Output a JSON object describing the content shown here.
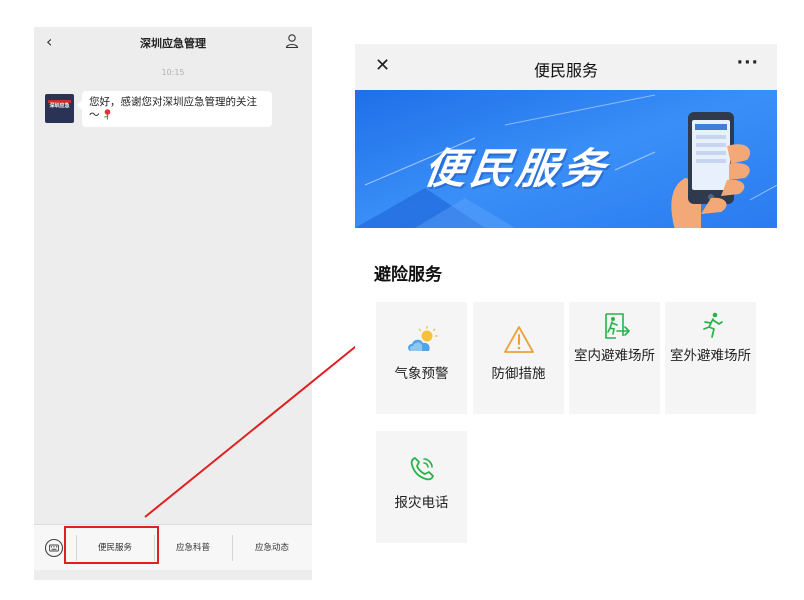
{
  "chat": {
    "back_icon": "chevron-left-icon",
    "title": "深圳应急管理",
    "user_icon": "person-icon",
    "time": "10:15",
    "message": "您好，感谢您对深圳应急管理的关注～",
    "avatar_text": "深圳应急",
    "menu": {
      "keyboard_icon": "keyboard-icon",
      "items": [
        {
          "label": "便民服务",
          "highlighted": true
        },
        {
          "label": "应急科普",
          "highlighted": false
        },
        {
          "label": "应急动态",
          "highlighted": false
        }
      ]
    }
  },
  "annotation": {
    "highlight_color": "#e02020",
    "arrow_icon": "red-arrow"
  },
  "service": {
    "close_icon": "close-icon",
    "title": "便民服务",
    "more_icon": "more-icon",
    "more_glyph": "···",
    "banner_text": "便民服务",
    "section_title": "避险服务",
    "tiles": [
      {
        "label": "气象预警",
        "icon": "weather-icon"
      },
      {
        "label": "防御措施",
        "icon": "warning-icon"
      },
      {
        "label": "室内避难场所",
        "icon": "indoor-shelter-icon"
      },
      {
        "label": "室外避难场所",
        "icon": "outdoor-shelter-icon"
      },
      {
        "label": "报灾电话",
        "icon": "phone-icon"
      }
    ]
  },
  "colors": {
    "banner_blue": "#2f86f6",
    "icon_green": "#27b34a",
    "warning_orange": "#e8a33d",
    "chat_bg": "#ededed"
  }
}
